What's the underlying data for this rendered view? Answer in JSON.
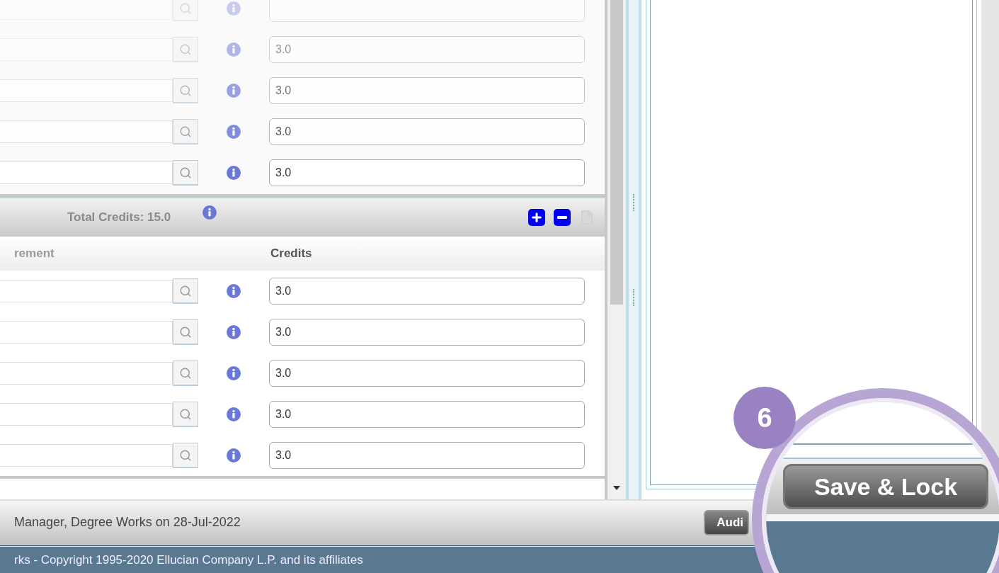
{
  "top_rows": [
    {
      "credits": ""
    },
    {
      "credits": "3.0"
    },
    {
      "credits": "3.0"
    },
    {
      "credits": "3.0"
    },
    {
      "credits": "3.0"
    }
  ],
  "section": {
    "total": "Total Credits: 15.0"
  },
  "columns": [
    "rement",
    "Credits"
  ],
  "bottom_rows": [
    {
      "credits": "3.0"
    },
    {
      "credits": "3.0"
    },
    {
      "credits": "3.0"
    },
    {
      "credits": "3.0"
    },
    {
      "credits": "3.0"
    }
  ],
  "status": "Manager, Degree Works on 28-Jul-2022",
  "buttons": [
    {
      "label": "Audi"
    }
  ],
  "callout": {
    "number": "6",
    "button": "Save & Lock"
  },
  "footer": "rks - Copyright 1995-2020 Ellucian Company L.P. and its affiliates"
}
